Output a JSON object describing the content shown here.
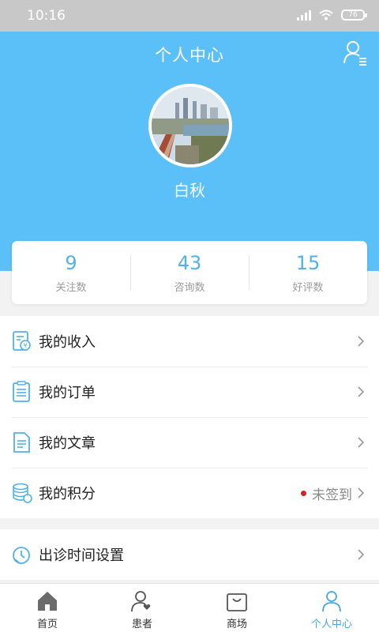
{
  "status_bar": {
    "time": "10:16",
    "battery": "76"
  },
  "header": {
    "title": "个人中心",
    "user_icon": "user-list-icon"
  },
  "profile": {
    "name": "白秋"
  },
  "stats": [
    {
      "value": "9",
      "label": "关注数"
    },
    {
      "value": "43",
      "label": "咨询数"
    },
    {
      "value": "15",
      "label": "好评数"
    }
  ],
  "menu": {
    "income": "我的收入",
    "orders": "我的订单",
    "articles": "我的文章",
    "points": "我的积分",
    "points_status": "未签到",
    "schedule": "出诊时间设置"
  },
  "tabs": [
    {
      "label": "首页",
      "icon": "home-icon"
    },
    {
      "label": "患者",
      "icon": "patient-icon"
    },
    {
      "label": "商场",
      "icon": "shopping-bag-icon"
    },
    {
      "label": "个人中心",
      "icon": "user-icon"
    }
  ],
  "colors": {
    "primary": "#5bc0f8",
    "accent": "#4fb3ea",
    "active_tab": "#45a9e6",
    "dot": "#e01e1e"
  }
}
